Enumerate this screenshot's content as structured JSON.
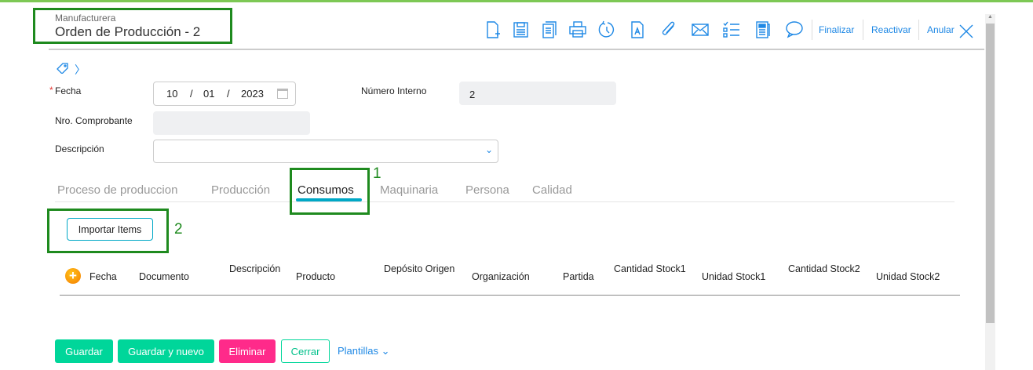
{
  "header": {
    "app": "Manufacturera",
    "title": "Orden de Producción - 2"
  },
  "toolbar": {
    "icons": [
      "new-document-icon",
      "save-icon",
      "copy-icon",
      "print-icon",
      "history-icon",
      "report-icon",
      "attach-icon",
      "email-icon",
      "checklist-icon",
      "document-view-icon",
      "comment-icon"
    ],
    "finalizar": "Finalizar",
    "reactivar": "Reactivar",
    "anular": "Anular"
  },
  "form": {
    "fecha_label": "Fecha",
    "required_mark": "*",
    "fecha_day": "10",
    "fecha_month": "01",
    "fecha_year": "2023",
    "sep": "/",
    "numero_label": "Número Interno",
    "numero_value": "2",
    "comprobante_label": "Nro. Comprobante",
    "comprobante_value": "",
    "descripcion_label": "Descripción",
    "descripcion_value": ""
  },
  "tabs": [
    "Proceso de produccion",
    "Producción",
    "Consumos",
    "Maquinaria",
    "Persona",
    "Calidad"
  ],
  "active_tab": "Consumos",
  "import_button": "Importar Items",
  "annotations": {
    "one": "1",
    "two": "2"
  },
  "table": {
    "columns": [
      "Fecha",
      "Documento",
      "Descripción",
      "Producto",
      "Depósito Origen",
      "Organización",
      "Partida",
      "Cantidad Stock1",
      "Unidad Stock1",
      "Cantidad Stock2",
      "Unidad Stock2"
    ]
  },
  "footer": {
    "guardar": "Guardar",
    "guardar_nuevo": "Guardar y nuevo",
    "eliminar": "Eliminar",
    "cerrar": "Cerrar",
    "plantillas": "Plantillas"
  },
  "colors": {
    "accent": "#1e88e5",
    "green": "#00d69a",
    "pink": "#ff2a8a",
    "tab_underline": "#00a8c6"
  }
}
